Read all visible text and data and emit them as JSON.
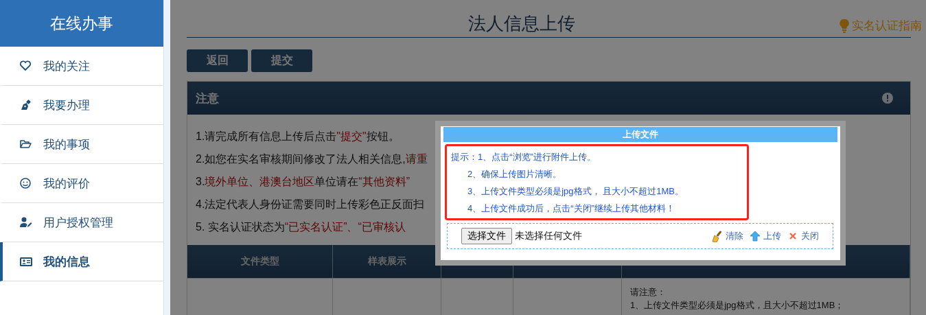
{
  "sidebar": {
    "title": "在线办事",
    "items": [
      {
        "label": "我的关注",
        "selected": false
      },
      {
        "label": "我要办理",
        "selected": false
      },
      {
        "label": "我的事项",
        "selected": false
      },
      {
        "label": "我的评价",
        "selected": false
      },
      {
        "label": "用户授权管理",
        "selected": false
      },
      {
        "label": "我的信息",
        "selected": true
      }
    ]
  },
  "page": {
    "title": "法人信息上传",
    "guide": "实名认证指南",
    "buttons": [
      "返回",
      "提交"
    ]
  },
  "notice": {
    "title": "注意",
    "lines": [
      [
        {
          "text": "1.请完成所有信息上传后点击",
          "red": false
        },
        {
          "text": "\"提交\"",
          "red": true
        },
        {
          "text": "按钮。",
          "red": false
        }
      ],
      [
        {
          "text": "2.如您在实名审核期间修改了法人相关信息,",
          "red": false
        },
        {
          "text": "请重",
          "red": true
        }
      ],
      [
        {
          "text": "3.",
          "red": false
        },
        {
          "text": "境外单位、港澳台地区",
          "red": true
        },
        {
          "text": "单位请在",
          "red": false
        },
        {
          "text": "“其他资料”",
          "red": true
        }
      ],
      [
        {
          "text": "4.法定代表人身份证需要同时上传彩色正反面扫",
          "red": false
        }
      ],
      [
        {
          "text": "5. 实名认证状态为",
          "red": false
        },
        {
          "text": "“已实名认证”、“已审核认",
          "red": true
        }
      ]
    ]
  },
  "table": {
    "columns": [
      "文件类型",
      "样表展示",
      "",
      "",
      ""
    ],
    "rows": [
      {
        "column_5": [
          "请注意：",
          "1、上传文件类型必须是jpg格式，且大小不超过1MB；"
        ]
      }
    ]
  },
  "dialog": {
    "title": "上传文件",
    "tips": [
      "提示：1、点击“浏览”进行附件上传。",
      "2、确保上传图片清晰。",
      "3、上传文件类型必须是jpg格式， 且大小不超过1MB。",
      "4、上传文件成功后，点击“关闭”继续上传其他材料！"
    ],
    "file_button": "选择文件",
    "file_status": "未选择任何文件",
    "actions": [
      {
        "label": "清除"
      },
      {
        "label": "上传"
      },
      {
        "label": "关闭"
      }
    ]
  }
}
